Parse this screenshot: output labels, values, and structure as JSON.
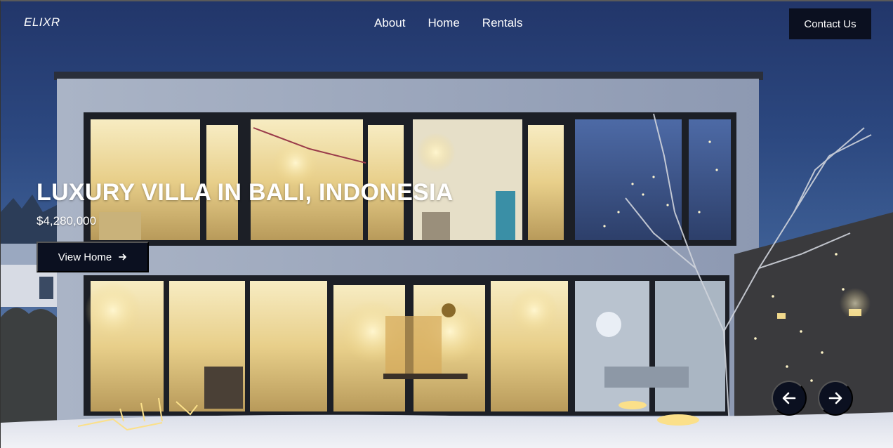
{
  "header": {
    "logo": "ELIXR",
    "nav": [
      {
        "label": "About"
      },
      {
        "label": "Home"
      },
      {
        "label": "Rentals"
      }
    ],
    "contact_label": "Contact Us"
  },
  "hero": {
    "title": "LUXURY VILLA IN BALI, INDONESIA",
    "price": "$4,280,000",
    "cta_label": "View Home",
    "cta_icon": "arrow-right-icon"
  },
  "carousel": {
    "prev_icon": "arrow-left-icon",
    "next_icon": "arrow-right-icon"
  },
  "colors": {
    "button_bg": "#0b1020",
    "text": "#ffffff",
    "sky": "#2c4880",
    "window_light": "#f3dfa0"
  }
}
